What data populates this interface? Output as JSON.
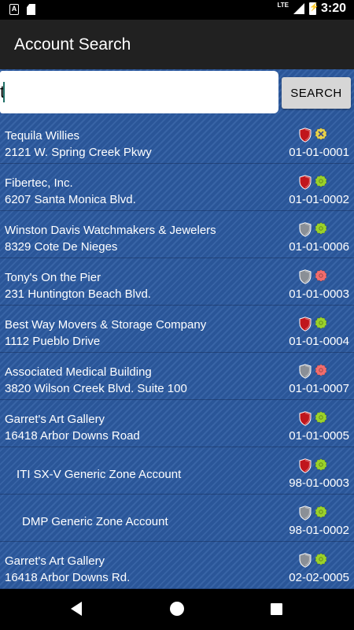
{
  "status_bar": {
    "network": "LTE",
    "time": "3:20"
  },
  "app_bar": {
    "title": "Account Search"
  },
  "search": {
    "value": "t",
    "button_label": "SEARCH"
  },
  "accounts": [
    {
      "name": "Tequila Willies",
      "address": "2121 W. Spring Creek Pkwy",
      "account": "01-01-0001",
      "indent": 0,
      "shield": "red",
      "status": "yellow-x"
    },
    {
      "name": "Fibertec, Inc.",
      "address": "6207 Santa Monica Blvd.",
      "account": "01-01-0002",
      "indent": 0,
      "shield": "red",
      "status": "green"
    },
    {
      "name": "Winston Davis Watchmakers & Jewelers",
      "address": "8329 Cote De Nieges",
      "account": "01-01-0006",
      "indent": 0,
      "shield": "gray",
      "status": "green"
    },
    {
      "name": "Tony's On the Pier",
      "address": "231 Huntington Beach Blvd.",
      "account": "01-01-0003",
      "indent": 0,
      "shield": "gray",
      "status": "red"
    },
    {
      "name": "Best Way Movers & Storage Company",
      "address": "1112 Pueblo Drive",
      "account": "01-01-0004",
      "indent": 0,
      "shield": "red",
      "status": "green"
    },
    {
      "name": "Associated Medical Building",
      "address": "3820 Wilson Creek Blvd.  Suite 100",
      "account": "01-01-0007",
      "indent": 0,
      "shield": "gray",
      "status": "red"
    },
    {
      "name": "Garret's Art Gallery",
      "address": "16418 Arbor Downs Road",
      "account": "01-01-0005",
      "indent": 0,
      "shield": "red",
      "status": "green"
    },
    {
      "name": "ITI SX-V Generic Zone Account",
      "address": "",
      "account": "98-01-0003",
      "indent": 1,
      "shield": "red",
      "status": "green"
    },
    {
      "name": "DMP Generic Zone Account",
      "address": "",
      "account": "98-01-0002",
      "indent": 2,
      "shield": "gray",
      "status": "green"
    },
    {
      "name": "Garret's Art Gallery",
      "address": "16418 Arbor Downs Rd.",
      "account": "02-02-0005",
      "indent": 0,
      "shield": "gray",
      "status": "green"
    }
  ],
  "colors": {
    "red": "#c0161c",
    "gray": "#8a8f96",
    "green": "#9bd22a",
    "yellow": "#e8d24a",
    "status_red": "#f26d6d"
  }
}
